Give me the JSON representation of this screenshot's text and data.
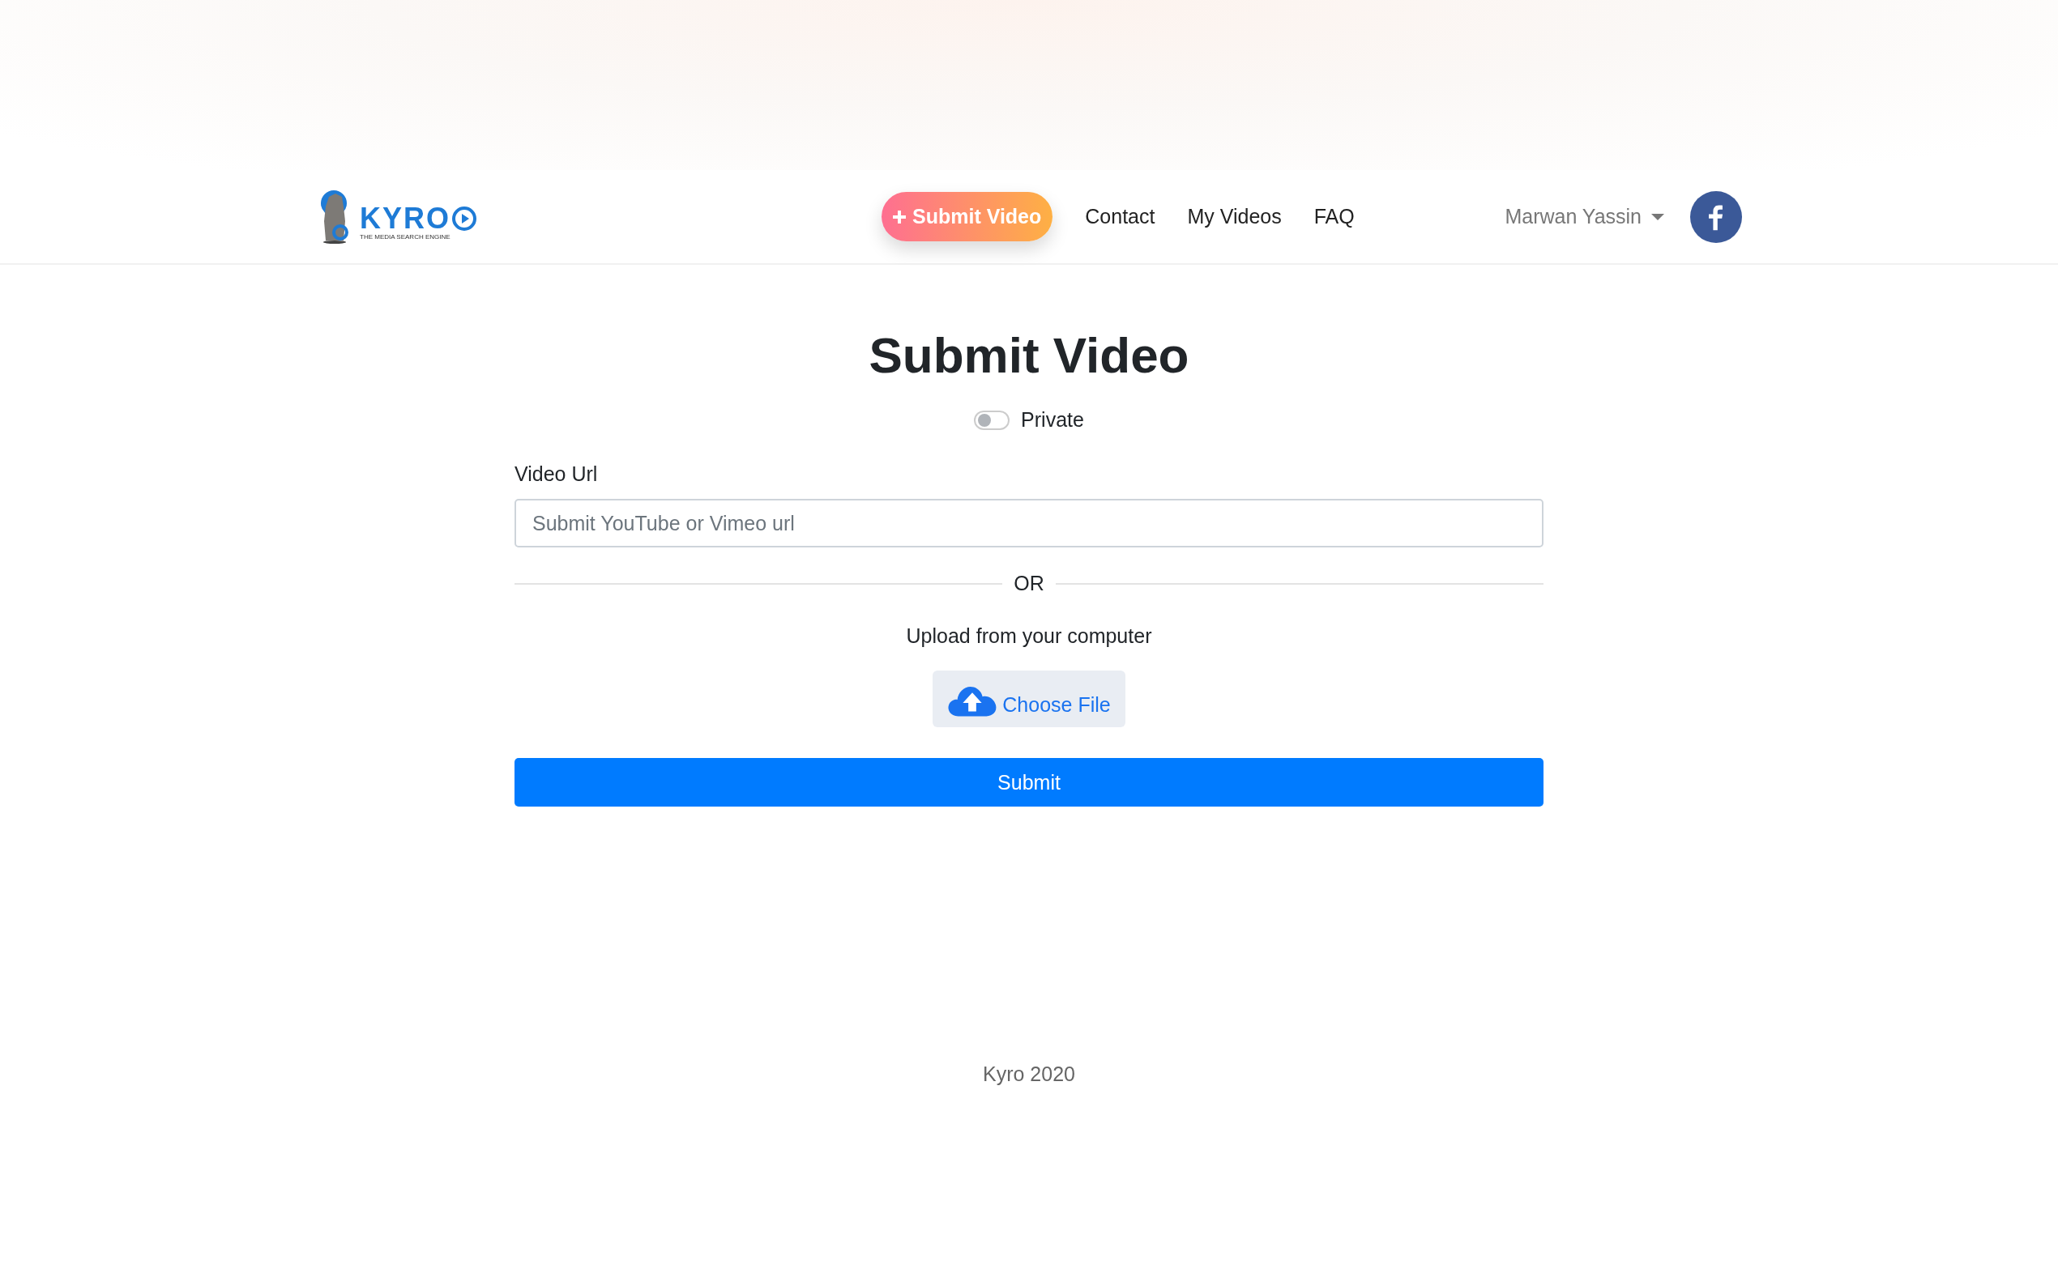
{
  "logo": {
    "wordmark": "KYRO",
    "tagline": "THE MEDIA SEARCH ENGINE"
  },
  "nav": {
    "cta": "Submit Video",
    "links": [
      "Contact",
      "My Videos",
      "FAQ"
    ],
    "user": "Marwan Yassin"
  },
  "form": {
    "title": "Submit Video",
    "private": {
      "label": "Private",
      "on": false
    },
    "url_label": "Video Url",
    "url_placeholder": "Submit YouTube or Vimeo url",
    "divider": "OR",
    "upload_label": "Upload from your computer",
    "choose_file": "Choose File",
    "submit": "Submit"
  },
  "footer": "Kyro 2020"
}
